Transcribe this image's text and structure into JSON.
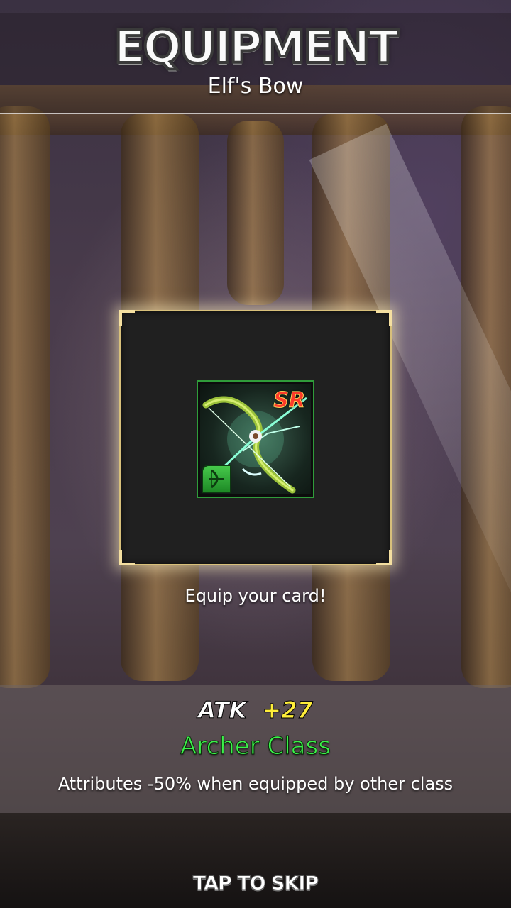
{
  "header": {
    "title": "EQUIPMENT",
    "item_name": "Elf's Bow"
  },
  "card": {
    "rarity": "SR",
    "icon": "bow-icon",
    "class_icon": "archer-class-icon",
    "frame_color": "#d8c07a",
    "border_color": "#2f9c3a"
  },
  "hint": "Equip your card!",
  "stats": {
    "atk_label": "ATK",
    "atk_value": "+27",
    "class_name": "Archer Class",
    "class_color": "#3cf04a",
    "attribute_note": "Attributes -50% when equipped by other class"
  },
  "footer": {
    "skip_label": "TAP TO SKIP"
  }
}
